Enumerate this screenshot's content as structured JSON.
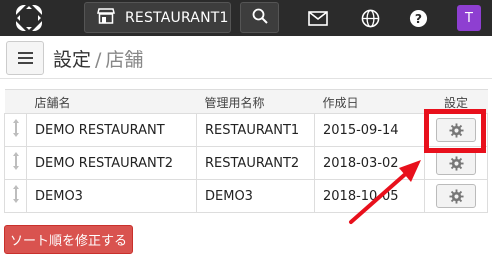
{
  "topbar": {
    "store_name": "RESTAURANT1",
    "avatar_letter": "T",
    "icons": [
      "logo-icon",
      "store-icon",
      "search-icon",
      "mail-icon",
      "globe-icon",
      "help-icon"
    ]
  },
  "header": {
    "title": "設定",
    "separator": "/",
    "subtitle": "店舗"
  },
  "table": {
    "columns": [
      "店舗名",
      "管理用名称",
      "作成日",
      "設定"
    ],
    "rows": [
      {
        "name": "DEMO RESTAURANT",
        "admin_name": "RESTAURANT1",
        "created": "2015-09-14"
      },
      {
        "name": "DEMO RESTAURANT2",
        "admin_name": "RESTAURANT2",
        "created": "2018-03-02"
      },
      {
        "name": "DEMO3",
        "admin_name": "DEMO3",
        "created": "2018-10-05"
      }
    ]
  },
  "actions": {
    "sort_label": "ソート順を修正する"
  },
  "colors": {
    "topbar_bg": "#2b2b2b",
    "avatar_bg": "#8e3fd1",
    "danger": "#d9534f",
    "highlight": "#e8101c"
  }
}
